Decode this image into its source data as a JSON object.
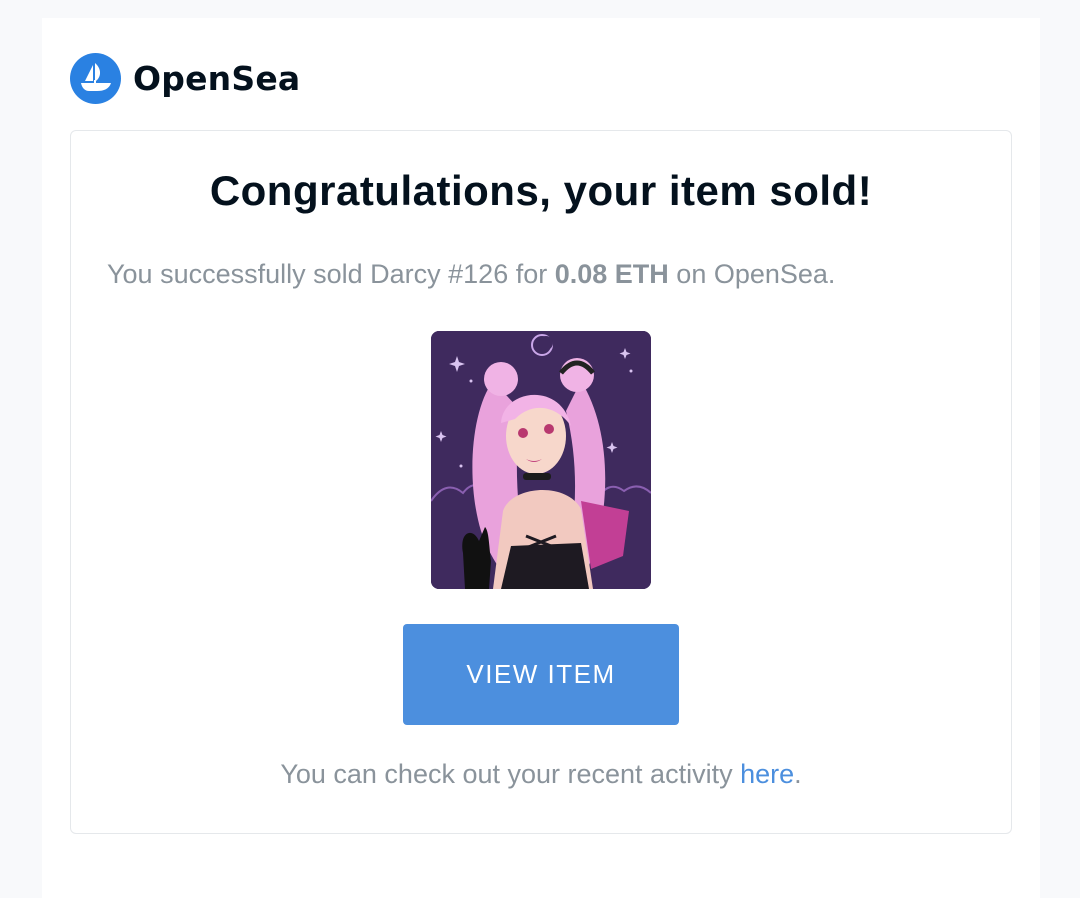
{
  "brand": {
    "name": "OpenSea",
    "logo_icon": "opensea-ship-icon",
    "logo_color": "#2a81e2"
  },
  "email": {
    "headline": "Congratulations, your item sold!",
    "message": {
      "prefix": "You successfully sold Darcy #126 for ",
      "price": "0.08 ETH",
      "suffix": " on OpenSea."
    },
    "item_image_icon": "nft-artwork-image",
    "button_label": "VIEW ITEM",
    "button_color": "#4c8fde",
    "footer": {
      "prefix": "You can check out your recent activity ",
      "link_text": "here",
      "suffix": "."
    }
  }
}
